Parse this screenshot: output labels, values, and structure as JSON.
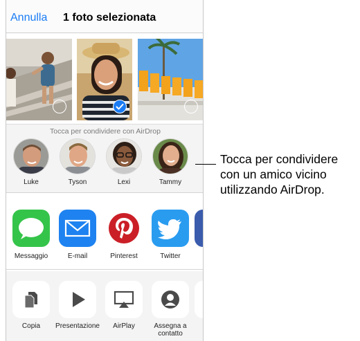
{
  "navbar": {
    "cancel_label": "Annulla",
    "title": "1 foto selezionata"
  },
  "photos": [
    {
      "id": "photo-1",
      "selected": false
    },
    {
      "id": "photo-2",
      "selected": true
    },
    {
      "id": "photo-3",
      "selected": false
    }
  ],
  "airdrop": {
    "hint": "Tocca per condividere con AirDrop",
    "people": [
      {
        "name": "Luke"
      },
      {
        "name": "Tyson"
      },
      {
        "name": "Lexi"
      },
      {
        "name": "Tammy"
      }
    ]
  },
  "apps": [
    {
      "label": "Messaggio",
      "icon": "messages-icon",
      "color": "#35c44a"
    },
    {
      "label": "E-mail",
      "icon": "mail-icon",
      "color": "#1e82f0"
    },
    {
      "label": "Pinterest",
      "icon": "pinterest-icon",
      "color": "#cb1f27"
    },
    {
      "label": "Twitter",
      "icon": "twitter-icon",
      "color": "#2a9cf0"
    }
  ],
  "actions": [
    {
      "label": "Copia",
      "icon": "copy-icon"
    },
    {
      "label": "Presentazione",
      "icon": "slideshow-icon"
    },
    {
      "label": "AirPlay",
      "icon": "airplay-icon"
    },
    {
      "label": "Assegna a contatto",
      "icon": "assign-contact-icon"
    }
  ],
  "callout": {
    "text": "Tocca per condividere con un amico vicino utilizzando AirDrop."
  },
  "colors": {
    "accent": "#1a7cf5"
  }
}
